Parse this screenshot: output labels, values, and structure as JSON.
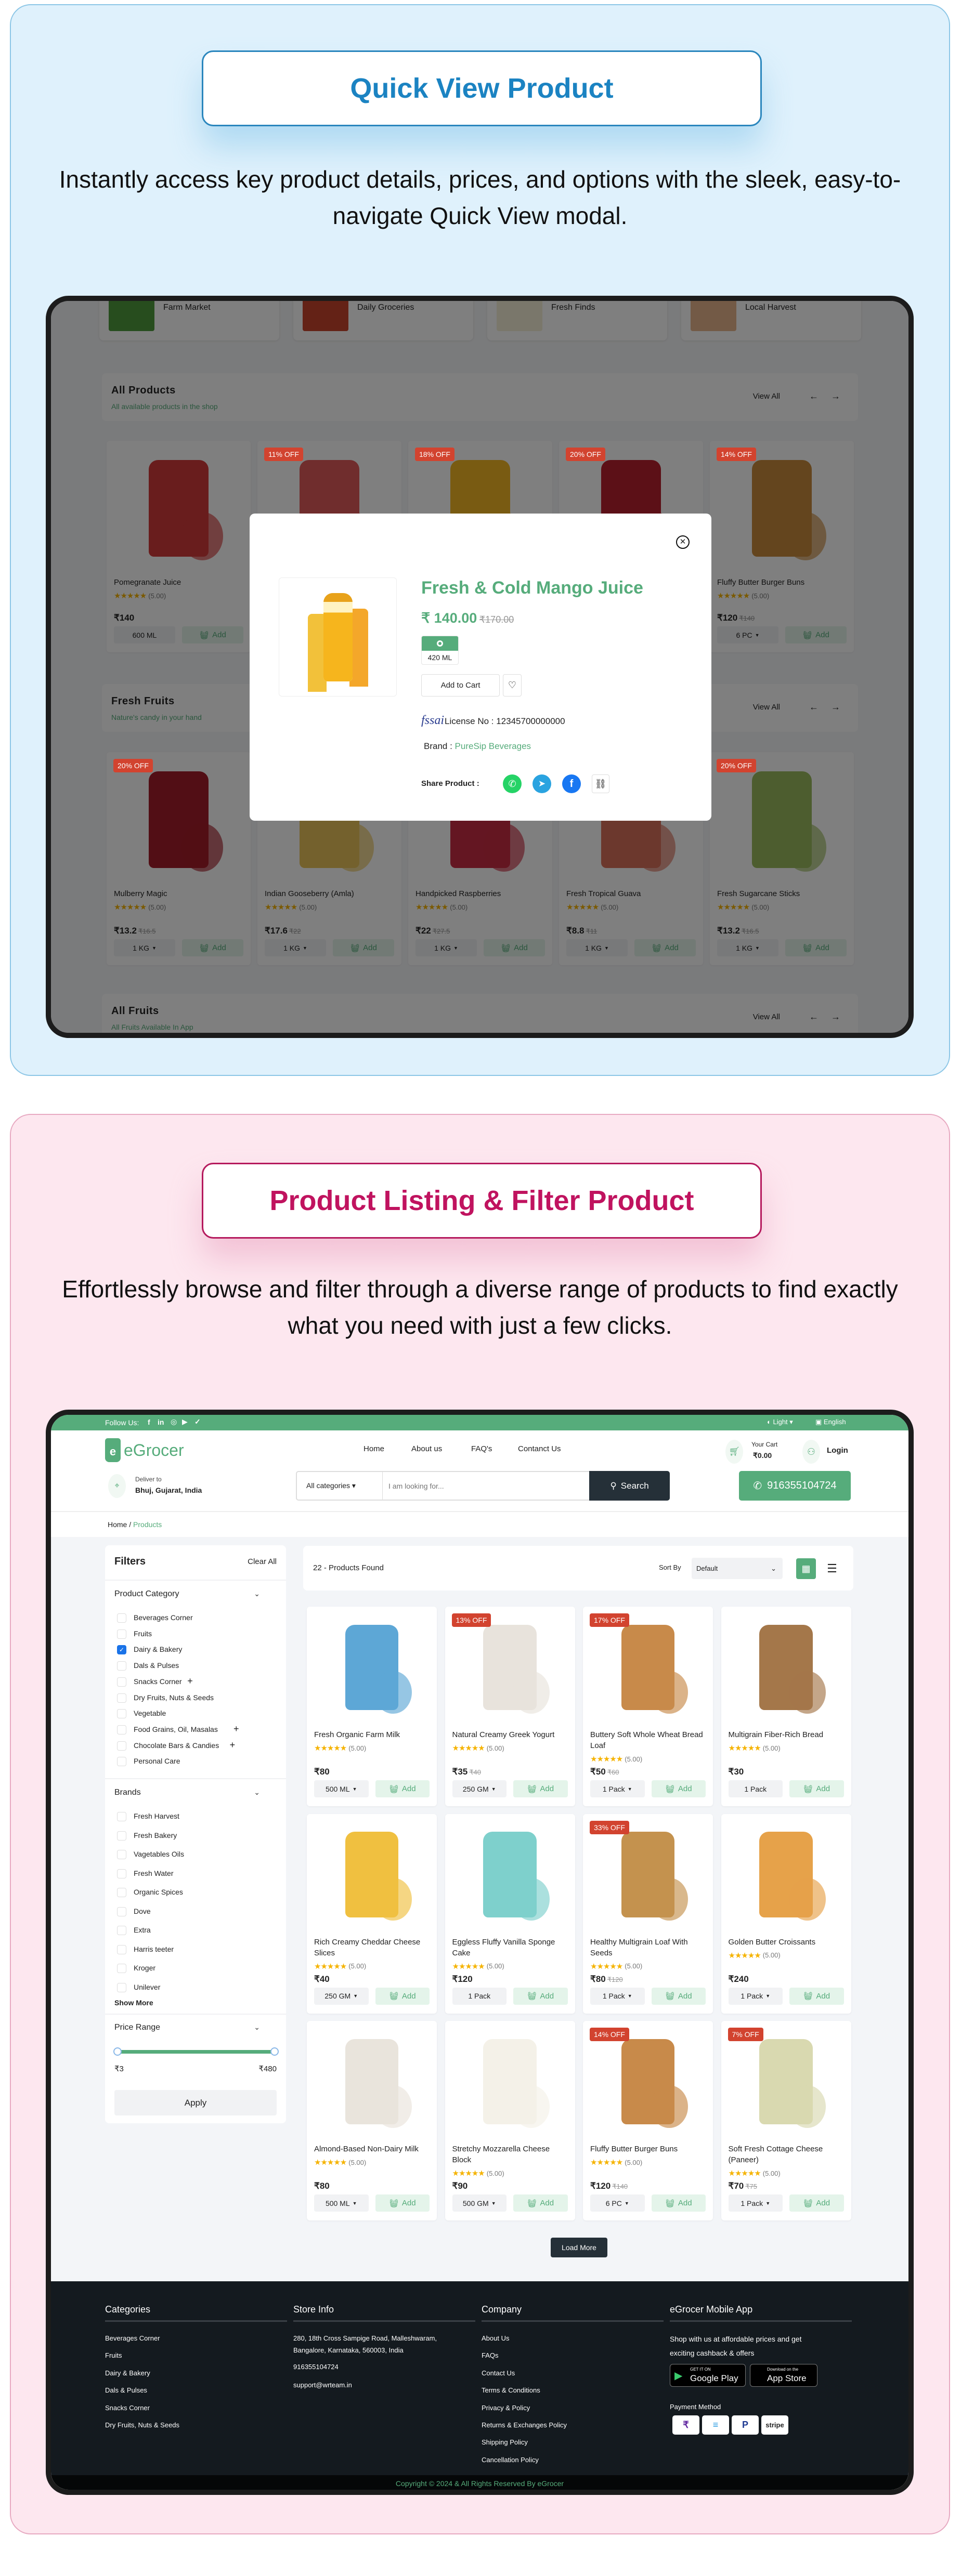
{
  "colors": {
    "brand_green": "#56ac7b",
    "discount_red": "#d2432f",
    "search_dark": "#253038",
    "footer_dark": "#141a1f",
    "quick_view_accent": "#1b83c2",
    "listing_accent": "#c0135f"
  },
  "quick_view_section": {
    "title": "Quick View Product",
    "description": "Instantly access key product details, prices, and options with the sleek, easy-to-navigate Quick View modal."
  },
  "listing_section": {
    "title": "Product Listing & Filter Product",
    "description": "Effortlessly browse and filter through a diverse range of products to find exactly what you need with just a few clicks."
  },
  "quick_view_demo": {
    "categories": [
      {
        "name": "Farm Market"
      },
      {
        "name": "Daily Groceries"
      },
      {
        "name": "Fresh Finds"
      },
      {
        "name": "Local Harvest"
      }
    ],
    "sections": [
      {
        "title": "All Products",
        "subtitle": "All available products in the shop",
        "view_all": "View All"
      },
      {
        "title": "Fresh Fruits",
        "subtitle": "Nature's candy in your hand",
        "view_all": "View All"
      },
      {
        "title": "All Fruits",
        "subtitle": "All Fruits Available In App",
        "view_all": "View All"
      }
    ],
    "all_products": [
      {
        "name": "Pomegranate Juice",
        "badge": "",
        "rating": "(5.00)",
        "price": "₹140",
        "old_price": "",
        "variant": "600 ML",
        "dropdown": false,
        "add_label": "Add"
      },
      {
        "name": "",
        "badge": "11% OFF",
        "rating": "",
        "price": "",
        "old_price": "",
        "variant": "",
        "dropdown": false,
        "add_label": ""
      },
      {
        "name": "",
        "badge": "18% OFF",
        "rating": "",
        "price": "",
        "old_price": "",
        "variant": "",
        "dropdown": false,
        "add_label": ""
      },
      {
        "name": "",
        "badge": "20% OFF",
        "rating": "",
        "price": "",
        "old_price": "",
        "variant": "",
        "dropdown": false,
        "add_label": ""
      },
      {
        "name": "Fluffy Butter Burger Buns",
        "badge": "14% OFF",
        "rating": "(5.00)",
        "price": "₹120",
        "old_price": "₹140",
        "variant": "6 PC",
        "dropdown": true,
        "add_label": "Add"
      }
    ],
    "fresh_fruits": [
      {
        "name": "Mulberry Magic",
        "badge": "20% OFF",
        "rating": "(5.00)",
        "price": "₹13.2",
        "old_price": "₹16.5",
        "variant": "1 KG",
        "dropdown": true,
        "add_label": "Add"
      },
      {
        "name": "Indian Gooseberry (Amla)",
        "badge": "",
        "rating": "(5.00)",
        "price": "₹17.6",
        "old_price": "₹22",
        "variant": "1 KG",
        "dropdown": true,
        "add_label": "Add"
      },
      {
        "name": "Handpicked Raspberries",
        "badge": "",
        "rating": "(5.00)",
        "price": "₹22",
        "old_price": "₹27.5",
        "variant": "1 KG",
        "dropdown": true,
        "add_label": "Add"
      },
      {
        "name": "Fresh Tropical Guava",
        "badge": "",
        "rating": "(5.00)",
        "price": "₹8.8",
        "old_price": "₹11",
        "variant": "1 KG",
        "dropdown": true,
        "add_label": "Add"
      },
      {
        "name": "Fresh Sugarcane Sticks",
        "badge": "20% OFF",
        "rating": "(5.00)",
        "price": "₹13.2",
        "old_price": "₹16.5",
        "variant": "1 KG",
        "dropdown": true,
        "add_label": "Add"
      }
    ],
    "modal": {
      "title": "Fresh & Cold Mango Juice",
      "price": "₹ 140.00",
      "old_price": "₹170.00",
      "variant": "420 ML",
      "add_to_cart": "Add to Cart",
      "license_logo": "fssai",
      "license": "License No : 12345700000000",
      "brand_label": "Brand :",
      "brand": "PureSip Beverages",
      "share_label": "Share Product :",
      "share_icons": [
        "whatsapp",
        "telegram",
        "facebook",
        "copy-link"
      ]
    }
  },
  "listing_demo": {
    "topbar": {
      "follow_us": "Follow Us:",
      "social": [
        "facebook",
        "linkedin",
        "instagram",
        "youtube",
        "twitter"
      ],
      "theme": "Light",
      "language": "English"
    },
    "header": {
      "logo": "eGrocer",
      "nav": [
        "Home",
        "About us",
        "FAQ's",
        "Contanct Us"
      ],
      "cart_label": "Your Cart",
      "cart_total": "₹0.00",
      "login": "Login",
      "deliver_label": "Deliver to",
      "deliver_location": "Bhuj, Gujarat, India",
      "category_select": "All categories",
      "search_placeholder": "I am looking for...",
      "search_button": "Search",
      "phone": "916355104724"
    },
    "breadcrumb": {
      "home": "Home",
      "separator": "/",
      "current": "Products"
    },
    "filters": {
      "title": "Filters",
      "clear_all": "Clear All",
      "category_heading": "Product Category",
      "categories": [
        {
          "label": "Beverages Corner",
          "checked": false,
          "expandable": false
        },
        {
          "label": "Fruits",
          "checked": false,
          "expandable": false
        },
        {
          "label": "Dairy & Bakery",
          "checked": true,
          "expandable": false
        },
        {
          "label": "Dals & Pulses",
          "checked": false,
          "expandable": false
        },
        {
          "label": "Snacks Corner",
          "checked": false,
          "expandable": true
        },
        {
          "label": "Dry Fruits, Nuts & Seeds",
          "checked": false,
          "expandable": false
        },
        {
          "label": "Vegetable",
          "checked": false,
          "expandable": false
        },
        {
          "label": "Food Grains, Oil, Masalas",
          "checked": false,
          "expandable": true
        },
        {
          "label": "Chocolate Bars & Candies",
          "checked": false,
          "expandable": true
        },
        {
          "label": "Personal Care",
          "checked": false,
          "expandable": false
        }
      ],
      "brands_heading": "Brands",
      "brands": [
        "Fresh Harvest",
        "Fresh Bakery",
        "Vagetables Oils",
        "Fresh Water",
        "Organic Spices",
        "Dove",
        "Extra",
        "Harris teeter",
        "Kroger",
        "Unilever"
      ],
      "show_more": "Show More",
      "price_heading": "Price Range",
      "price_min": "₹3",
      "price_max": "₹480",
      "price_range_fraction": [
        0,
        1
      ],
      "apply": "Apply"
    },
    "results": {
      "count_text": "22 - Products Found",
      "sort_label": "Sort By",
      "sort_value": "Default",
      "view_mode": "grid"
    },
    "products": [
      {
        "name": "Fresh Organic Farm Milk",
        "badge": "",
        "rating": "(5.00)",
        "price": "₹80",
        "old_price": "",
        "variant": "500 ML",
        "dropdown": true,
        "add_label": "Add"
      },
      {
        "name": "Natural Creamy Greek Yogurt",
        "badge": "13% OFF",
        "rating": "(5.00)",
        "price": "₹35",
        "old_price": "₹40",
        "variant": "250 GM",
        "dropdown": true,
        "add_label": "Add"
      },
      {
        "name": "Buttery Soft Whole Wheat Bread Loaf",
        "badge": "17% OFF",
        "rating": "(5.00)",
        "price": "₹50",
        "old_price": "₹60",
        "variant": "1 Pack",
        "dropdown": true,
        "add_label": "Add"
      },
      {
        "name": "Multigrain Fiber-Rich Bread",
        "badge": "",
        "rating": "(5.00)",
        "price": "₹30",
        "old_price": "",
        "variant": "1 Pack",
        "dropdown": false,
        "add_label": "Add"
      },
      {
        "name": "Rich Creamy Cheddar Cheese Slices",
        "badge": "",
        "rating": "(5.00)",
        "price": "₹40",
        "old_price": "",
        "variant": "250 GM",
        "dropdown": true,
        "add_label": "Add"
      },
      {
        "name": "Eggless Fluffy Vanilla Sponge Cake",
        "badge": "",
        "rating": "(5.00)",
        "price": "₹120",
        "old_price": "",
        "variant": "1 Pack",
        "dropdown": false,
        "add_label": "Add"
      },
      {
        "name": "Healthy Multigrain Loaf With Seeds",
        "badge": "33% OFF",
        "rating": "(5.00)",
        "price": "₹80",
        "old_price": "₹120",
        "variant": "1 Pack",
        "dropdown": true,
        "add_label": "Add"
      },
      {
        "name": "Golden Butter Croissants",
        "badge": "",
        "rating": "(5.00)",
        "price": "₹240",
        "old_price": "",
        "variant": "1 Pack",
        "dropdown": true,
        "add_label": "Add"
      },
      {
        "name": "Almond-Based Non-Dairy Milk",
        "badge": "",
        "rating": "(5.00)",
        "price": "₹80",
        "old_price": "",
        "variant": "500 ML",
        "dropdown": true,
        "add_label": "Add"
      },
      {
        "name": "Stretchy Mozzarella Cheese Block",
        "badge": "",
        "rating": "(5.00)",
        "price": "₹90",
        "old_price": "",
        "variant": "500 GM",
        "dropdown": true,
        "add_label": "Add"
      },
      {
        "name": "Fluffy Butter Burger Buns",
        "badge": "14% OFF",
        "rating": "(5.00)",
        "price": "₹120",
        "old_price": "₹140",
        "variant": "6 PC",
        "dropdown": true,
        "add_label": "Add"
      },
      {
        "name": "Soft Fresh Cottage Cheese (Paneer)",
        "badge": "7% OFF",
        "rating": "(5.00)",
        "price": "₹70",
        "old_price": "₹75",
        "variant": "1 Pack",
        "dropdown": true,
        "add_label": "Add"
      }
    ],
    "load_more": "Load More",
    "footer": {
      "categories_heading": "Categories",
      "categories": [
        "Beverages Corner",
        "Fruits",
        "Dairy & Bakery",
        "Dals & Pulses",
        "Snacks Corner",
        "Dry Fruits, Nuts & Seeds"
      ],
      "store_heading": "Store Info",
      "address_line1": "280, 18th Cross Sampige Road, Malleshwaram,",
      "address_line2": "Bangalore, Karnataka, 560003, India",
      "phone": "916355104724",
      "email": "support@wrteam.in",
      "company_heading": "Company",
      "company_links": [
        "About Us",
        "FAQs",
        "Contact Us",
        "Terms & Conditions",
        "Privacy & Policy",
        "Returns & Exchanges Policy",
        "Shipping Policy",
        "Cancellation Policy"
      ],
      "app_heading": "eGrocer Mobile App",
      "app_text_line1": "Shop with us at affordable prices and get",
      "app_text_line2": "exciting cashback & offers",
      "google_play_small": "GET IT ON",
      "google_play": "Google Play",
      "app_store_small": "Download on the",
      "app_store": "App Store",
      "payment_heading": "Payment Method",
      "payment_methods": [
        "phonepe",
        "razorpay",
        "paypal",
        "stripe"
      ],
      "copyright": "Copyright © 2024 & All Rights Reserved By eGrocer"
    }
  }
}
